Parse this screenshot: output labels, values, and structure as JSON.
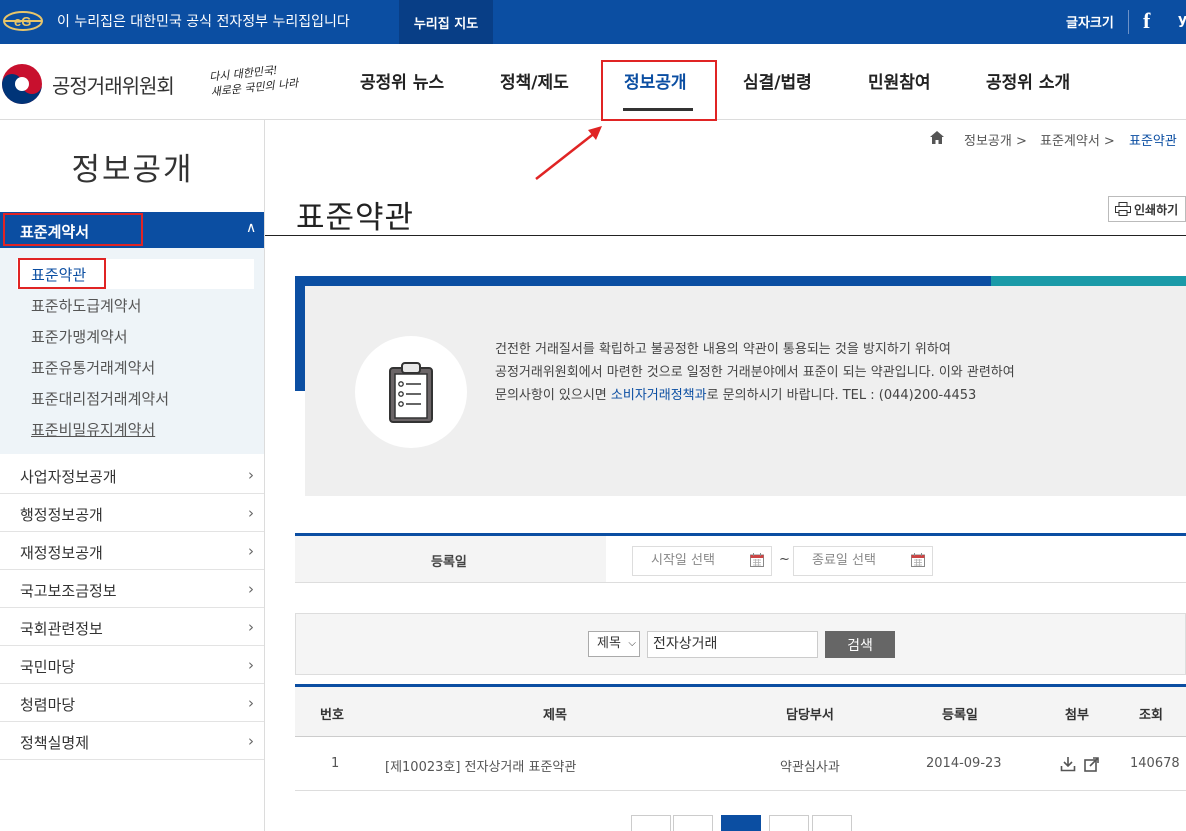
{
  "gov_banner": {
    "notice": "이 누리집은 대한민국 공식 전자정부 누리집입니다",
    "sitemap": "누리집 지도",
    "font_size": "글자크기",
    "facebook_glyph": "f",
    "twitter_glyph": "y"
  },
  "header": {
    "org_name": "공정거래위원회",
    "slogan_line1": "다시 대한민국!",
    "slogan_line2": "새로운 국민의 나라",
    "nav": [
      {
        "label": "공정위 뉴스"
      },
      {
        "label": "정책/제도"
      },
      {
        "label": "정보공개",
        "active": true
      },
      {
        "label": "심결/법령"
      },
      {
        "label": "민원참여"
      },
      {
        "label": "공정위 소개"
      }
    ]
  },
  "sidebar": {
    "title": "정보공개",
    "active_section": "표준계약서",
    "sub_items": [
      {
        "label": "표준약관",
        "selected": true
      },
      {
        "label": "표준하도급계약서"
      },
      {
        "label": "표준가맹계약서"
      },
      {
        "label": "표준유통거래계약서"
      },
      {
        "label": "표준대리점거래계약서"
      },
      {
        "label": "표준비밀유지계약서"
      }
    ],
    "menu": [
      {
        "label": "사업자정보공개"
      },
      {
        "label": "행정정보공개"
      },
      {
        "label": "재정정보공개"
      },
      {
        "label": "국고보조금정보"
      },
      {
        "label": "국회관련정보"
      },
      {
        "label": "국민마당"
      },
      {
        "label": "청렴마당"
      },
      {
        "label": "정책실명제"
      }
    ]
  },
  "breadcrumb": [
    "정보공개 >",
    "표준계약서 >",
    "표준약관"
  ],
  "page_title": "표준약관",
  "print_label": "인쇄하기",
  "info": {
    "line1": "건전한 거래질서를 확립하고 불공정한 내용의 약관이 통용되는 것을 방지하기 위하여",
    "line2": "공정거래위원회에서 마련한 것으로 일정한 거래분야에서 표준이 되는 약관입니다. 이와 관련하여",
    "line3_prefix": "문의사항이 있으시면 ",
    "line3_link": "소비자거래정책과",
    "line3_suffix": "로 문의하시기 바랍니다. TEL : (044)200-4453"
  },
  "filter": {
    "label": "등록일",
    "start_placeholder": "시작일 선택",
    "end_placeholder": "종료일 선택",
    "separator": "~"
  },
  "search": {
    "field_select": "제목",
    "keyword": "전자상거래",
    "button": "검색"
  },
  "table": {
    "columns": [
      "번호",
      "제목",
      "담당부서",
      "등록일",
      "첨부",
      "조회"
    ],
    "rows": [
      {
        "no": "1",
        "title": "[제10023호] 전자상거래 표준약관",
        "dept": "약관심사과",
        "date": "2014-09-23",
        "views": "140678"
      }
    ]
  },
  "colors": {
    "primary": "#0b4ea2",
    "teal": "#1a9aa8",
    "highlight": "#e02424"
  }
}
